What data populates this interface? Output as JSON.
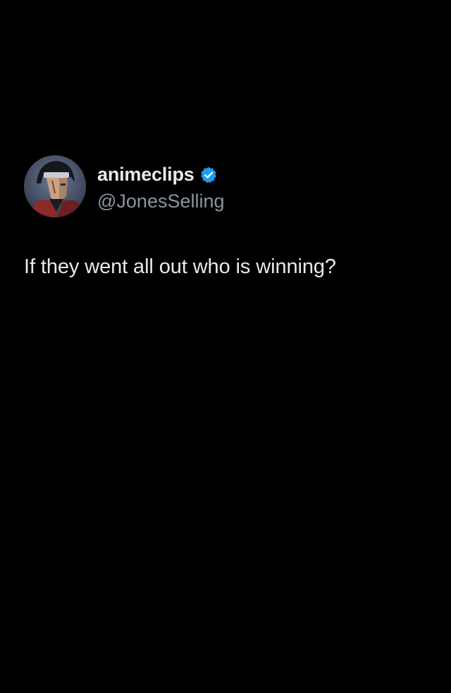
{
  "post": {
    "author": {
      "display_name": "animeclips",
      "handle": "@JonesSelling",
      "verified_icon": "verified-badge-icon",
      "avatar": "avatar-anime-character"
    },
    "text": "If they went all out who is winning?"
  },
  "colors": {
    "background": "#000000",
    "primary_text": "#e7e9ea",
    "secondary_text": "#8b949c",
    "verified_blue": "#1d9bf0"
  }
}
